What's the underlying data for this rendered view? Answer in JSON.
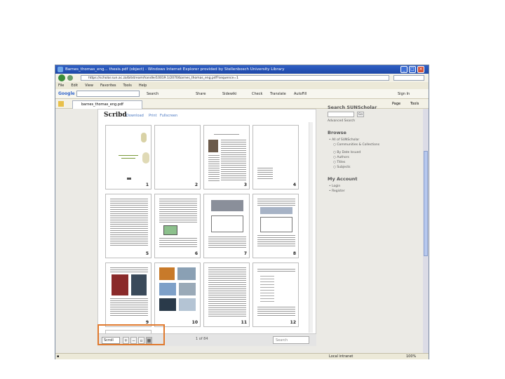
{
  "window": {
    "title": "Barnes_thomas_eng... thesis.pdf (object) - Windows Internet Explorer provided by Stellenbosch University Library",
    "address": "https://scholar.sun.ac.za/bitstream/handle/10019.1/2070/barnes_thomas_eng.pdf?sequence=1",
    "min_label": "_",
    "max_label": "□",
    "close_label": "×"
  },
  "menu": [
    "File",
    "Edit",
    "View",
    "Favorites",
    "Tools",
    "Help"
  ],
  "google_bar": {
    "logo": "Google",
    "search_label": "Search",
    "share_label": "Share",
    "sidewiki_label": "Sidewiki",
    "check_label": "Check",
    "translate_label": "Translate",
    "autofill_label": "AutoFill",
    "signin_label": "Sign In"
  },
  "tab": {
    "label": "barnes_thomas_eng.pdf",
    "page_label": "Page",
    "tools_label": "Tools"
  },
  "scribd": {
    "logo": "Scribd",
    "links": [
      "Download",
      "Print",
      "Fullscreen"
    ],
    "pages": [
      "1",
      "2",
      "3",
      "4",
      "5",
      "6",
      "7",
      "8",
      "9",
      "10",
      "11",
      "12"
    ],
    "zoom_select": "Scroll",
    "page_indicator": "1 of 84",
    "search_placeholder": "Search"
  },
  "sidebar": {
    "search_title": "Search SUNScholar",
    "go_label": "Go",
    "advanced_label": "Advanced Search",
    "browse_title": "Browse",
    "browse_items": [
      "All of SUNScholar",
      "Communities & Collections",
      "By Date Issued",
      "Authors",
      "Titles",
      "Subjects"
    ],
    "account_title": "My Account",
    "account_items": [
      "Login",
      "Register"
    ]
  },
  "status": {
    "zone": "Local intranet",
    "zoom": "100%"
  },
  "colors": {
    "highlight_box": "#e07a2e",
    "titlebar": "#2f5fc4"
  }
}
